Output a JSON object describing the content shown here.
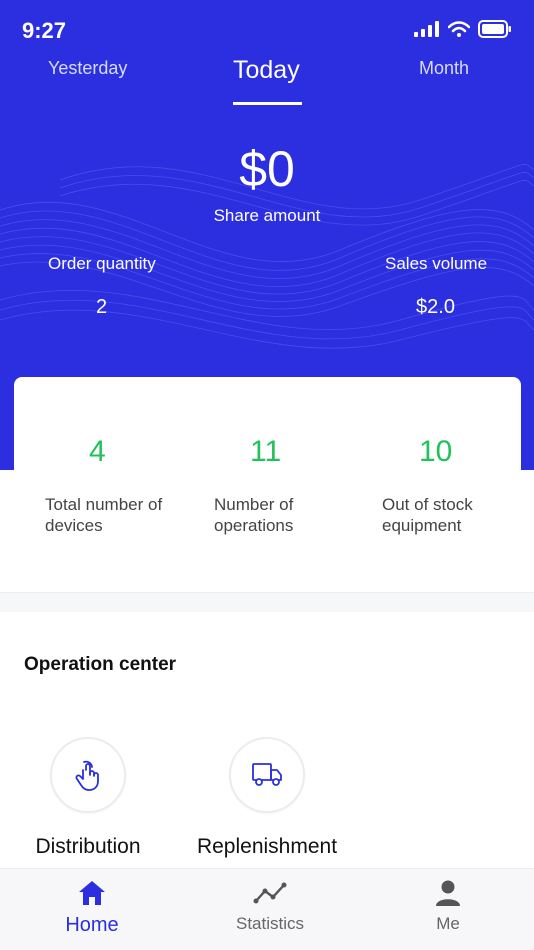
{
  "status_bar": {
    "time": "9:27",
    "icons": [
      "signal-icon",
      "wifi-icon",
      "battery-icon"
    ]
  },
  "period_tabs": [
    {
      "label": "Yesterday",
      "active": false
    },
    {
      "label": "Today",
      "active": true
    },
    {
      "label": "Month",
      "active": false
    }
  ],
  "summary": {
    "share_value": "$0",
    "share_label": "Share amount",
    "order_quantity_label": "Order quantity",
    "order_quantity_value": "2",
    "sales_volume_label": "Sales volume",
    "sales_volume_value": "$2.0"
  },
  "stats": [
    {
      "value": "4",
      "label_line1": "Total number of",
      "label_line2": "devices"
    },
    {
      "value": "11",
      "label_line1": "Number of",
      "label_line2": "operations"
    },
    {
      "value": "10",
      "label_line1": "Out of stock",
      "label_line2": "equipment"
    }
  ],
  "operation_center": {
    "title": "Operation center",
    "items": [
      {
        "label": "Distribution",
        "icon": "hand-pointer-icon"
      },
      {
        "label": "Replenishment",
        "icon": "truck-icon"
      }
    ]
  },
  "bottom_nav": [
    {
      "label": "Home",
      "icon": "home-icon",
      "active": true
    },
    {
      "label": "Statistics",
      "icon": "chart-line-icon",
      "active": false
    },
    {
      "label": "Me",
      "icon": "person-icon",
      "active": false
    }
  ],
  "colors": {
    "brand_blue": "#2b2fe0",
    "stat_green": "#22c25a",
    "inactive_tab": "#d7dbff"
  }
}
